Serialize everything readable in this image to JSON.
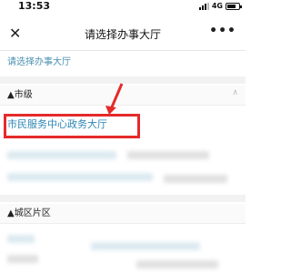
{
  "status_bar": {
    "time": "13:53",
    "network": "4G"
  },
  "nav": {
    "close_icon_glyph": "✕",
    "title": "请选择办事大厅",
    "more_glyph": "•••"
  },
  "prompt_text": "请选择办事大厅",
  "sections": [
    {
      "title": "▲市级",
      "chevron": "∧"
    },
    {
      "title": "▲城区片区"
    }
  ],
  "halls": [
    "市民服务中心政务大厅"
  ],
  "colors": {
    "link": "#2e86b4",
    "highlight": "#e52a2a"
  }
}
